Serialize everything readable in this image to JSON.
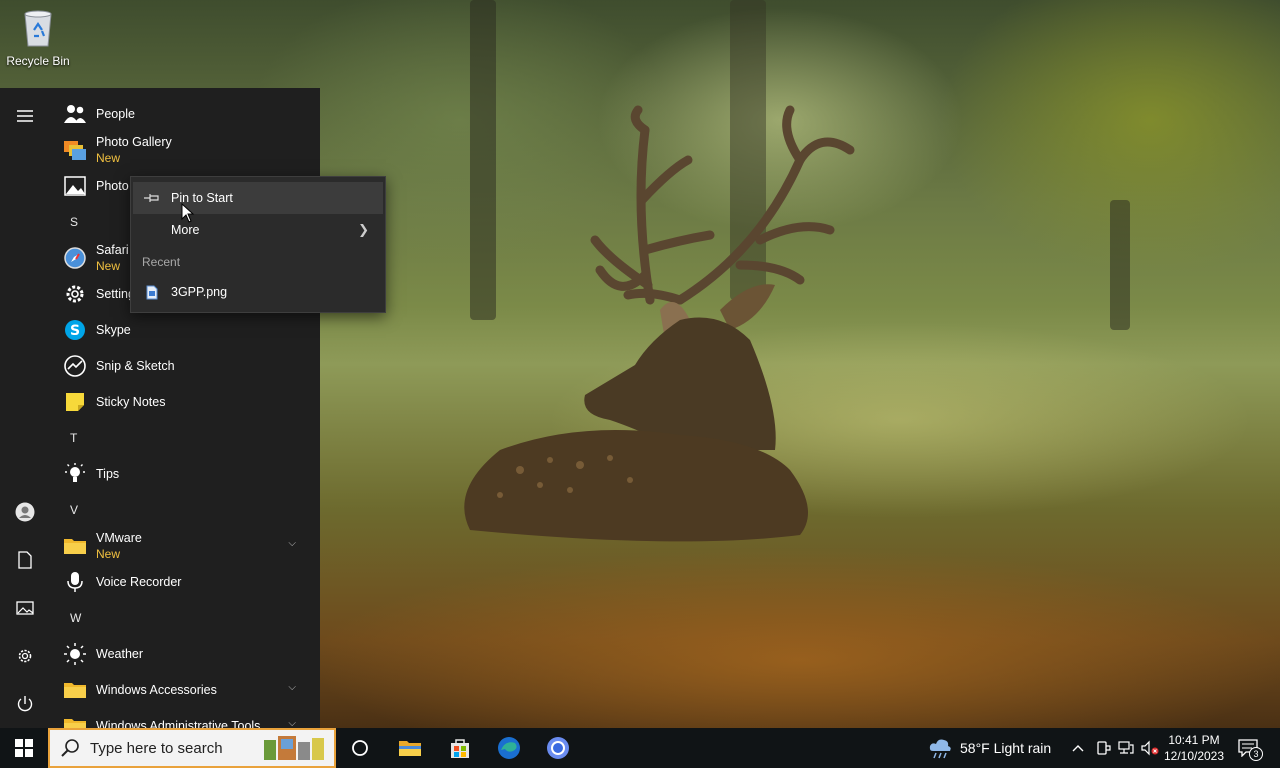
{
  "desktop": {
    "recycle_bin_label": "Recycle Bin"
  },
  "start_menu": {
    "apps": [
      {
        "label": "People",
        "sub": ""
      },
      {
        "label": "Photo Gallery",
        "sub": "New"
      },
      {
        "label": "Photo",
        "sub": ""
      },
      {
        "letter": "S"
      },
      {
        "label": "Safari",
        "sub": "New"
      },
      {
        "label": "Setting",
        "sub": ""
      },
      {
        "label": "Skype",
        "sub": ""
      },
      {
        "label": "Snip & Sketch",
        "sub": ""
      },
      {
        "label": "Sticky Notes",
        "sub": ""
      },
      {
        "letter": "T"
      },
      {
        "label": "Tips",
        "sub": ""
      },
      {
        "letter": "V"
      },
      {
        "label": "VMware",
        "sub": "New"
      },
      {
        "label": "Voice Recorder",
        "sub": ""
      },
      {
        "letter": "W"
      },
      {
        "label": "Weather",
        "sub": ""
      },
      {
        "label": "Windows Accessories",
        "sub": ""
      },
      {
        "label": "Windows Administrative Tools",
        "sub": ""
      }
    ]
  },
  "context_menu": {
    "pin_to_start": "Pin to Start",
    "more": "More",
    "recent_heading": "Recent",
    "recent_file": "3GPP.png"
  },
  "taskbar": {
    "search_placeholder": "Type here to search",
    "weather": "58°F  Light rain",
    "time": "10:41 PM",
    "date": "12/10/2023",
    "notification_count": "3"
  },
  "colors": {
    "start_bg": "#1f1f1f",
    "new_badge": "#f0c040",
    "search_border": "#e9a23b",
    "taskbar_bg": "#101416"
  }
}
